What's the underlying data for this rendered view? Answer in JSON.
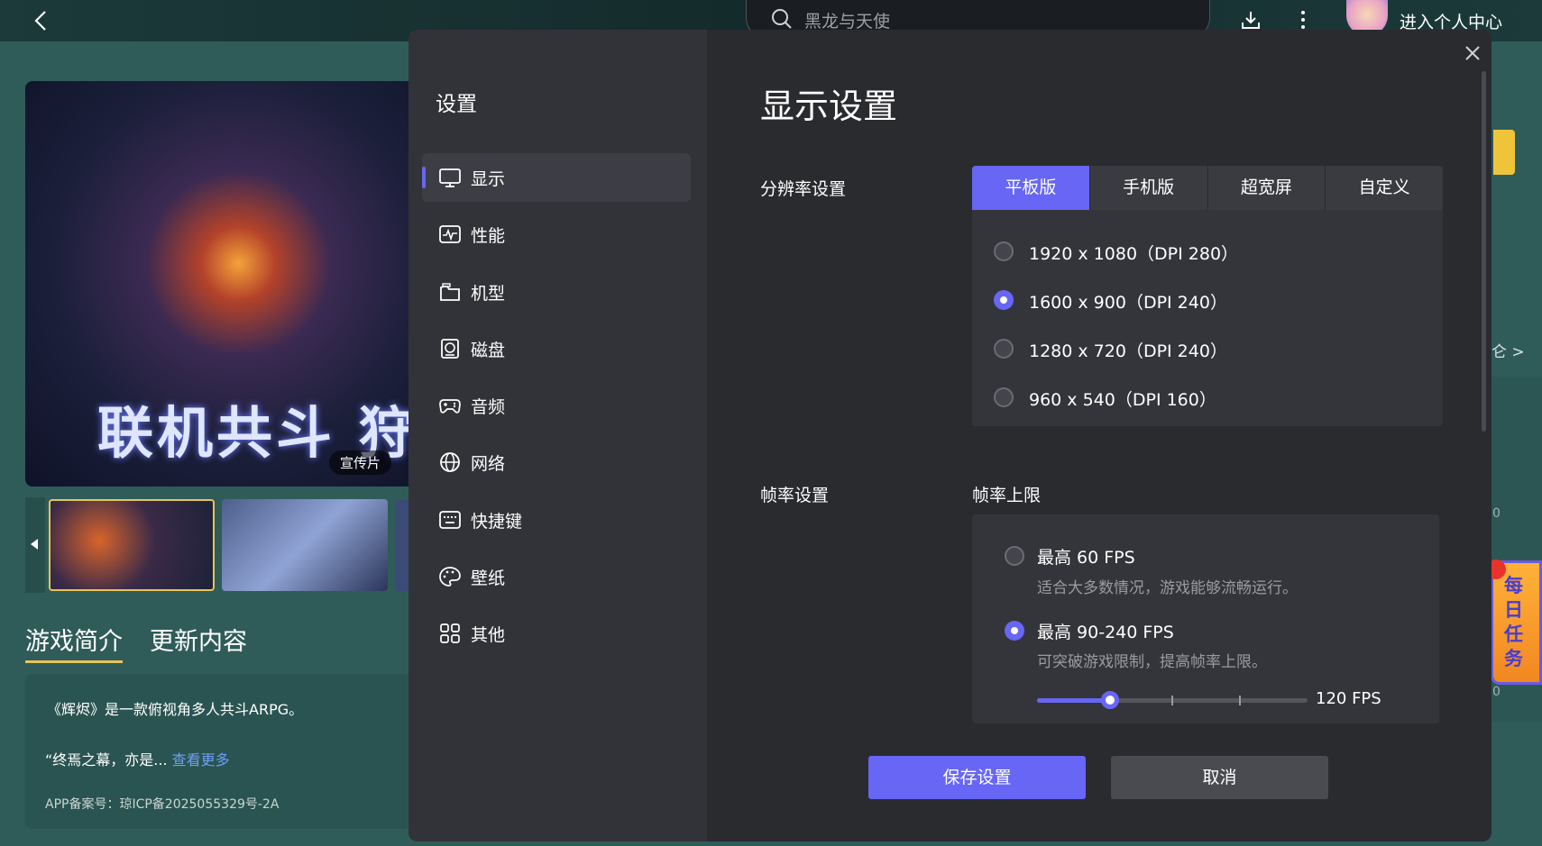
{
  "topbar": {
    "search_placeholder": "黑龙与天使",
    "profile_link": "进入个人中心"
  },
  "game": {
    "banner_text": "联机共斗 狩猎榕",
    "video_tag": "宣传片",
    "tabs": [
      "游戏简介",
      "更新内容"
    ],
    "intro_line1": "《辉烬》是一款俯视角多人共斗ARPG。",
    "intro_line2": "“终焉之幕，亦是...",
    "see_more": "查看更多",
    "icp": "APP备案号：琼ICP备2025055329号-2A"
  },
  "right_side": {
    "link_fragment": "仑 >",
    "count_1": "0",
    "count_2": "0",
    "daily_task": "每日任务"
  },
  "settings": {
    "title": "设置",
    "nav": [
      {
        "label": "显示",
        "icon": "monitor-icon",
        "active": true
      },
      {
        "label": "性能",
        "icon": "pulse-icon",
        "active": false
      },
      {
        "label": "机型",
        "icon": "device-icon",
        "active": false
      },
      {
        "label": "磁盘",
        "icon": "disk-icon",
        "active": false
      },
      {
        "label": "音频",
        "icon": "gamepad-icon",
        "active": false
      },
      {
        "label": "网络",
        "icon": "globe-icon",
        "active": false
      },
      {
        "label": "快捷键",
        "icon": "keyboard-icon",
        "active": false
      },
      {
        "label": "壁纸",
        "icon": "palette-icon",
        "active": false
      },
      {
        "label": "其他",
        "icon": "grid-icon",
        "active": false
      }
    ],
    "page_title": "显示设置",
    "resolution": {
      "label": "分辨率设置",
      "tabs": [
        "平板版",
        "手机版",
        "超宽屏",
        "自定义"
      ],
      "active_tab": "平板版",
      "options": [
        "1920 x 1080（DPI 280）",
        "1600 x 900（DPI 240）",
        "1280 x 720（DPI 240）",
        "960 x 540（DPI 160）"
      ],
      "selected": "1600 x 900（DPI 240）"
    },
    "framerate": {
      "label": "帧率设置",
      "sub_label": "帧率上限",
      "options": [
        {
          "title": "最高 60 FPS",
          "desc": "适合大多数情况，游戏能够流畅运行。"
        },
        {
          "title": "最高 90-240 FPS",
          "desc": "可突破游戏限制，提高帧率上限。"
        }
      ],
      "selected": "最高 90-240 FPS",
      "slider_value": "120 FPS",
      "slider_fraction": 0.27
    },
    "save_label": "保存设置",
    "cancel_label": "取消"
  },
  "colors": {
    "accent": "#6766f5",
    "modal_bg": "#2a2b2f",
    "sidebar_bg": "#323338",
    "page_bg": "#2f5c59"
  }
}
